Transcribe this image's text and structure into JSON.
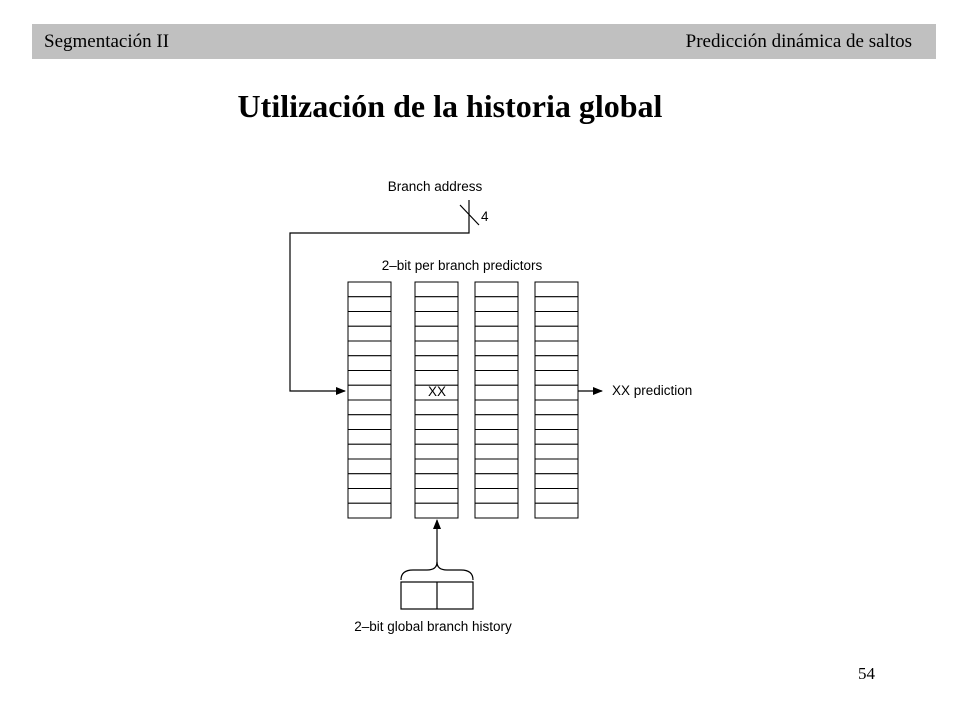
{
  "header": {
    "left": "Segmentación II",
    "right": "Predicción dinámica de saltos"
  },
  "title": "Utilización  de la historia global",
  "page_number": "54",
  "diagram": {
    "branch_address_label": "Branch address",
    "bus_width_label": "4",
    "predictors_label": "2–bit per branch predictors",
    "selected_entry_label": "XX",
    "output_label": "XX prediction",
    "history_label": "2–bit global branch history",
    "predictor_columns": 4,
    "rows_per_column": 16,
    "history_bits": 2
  }
}
